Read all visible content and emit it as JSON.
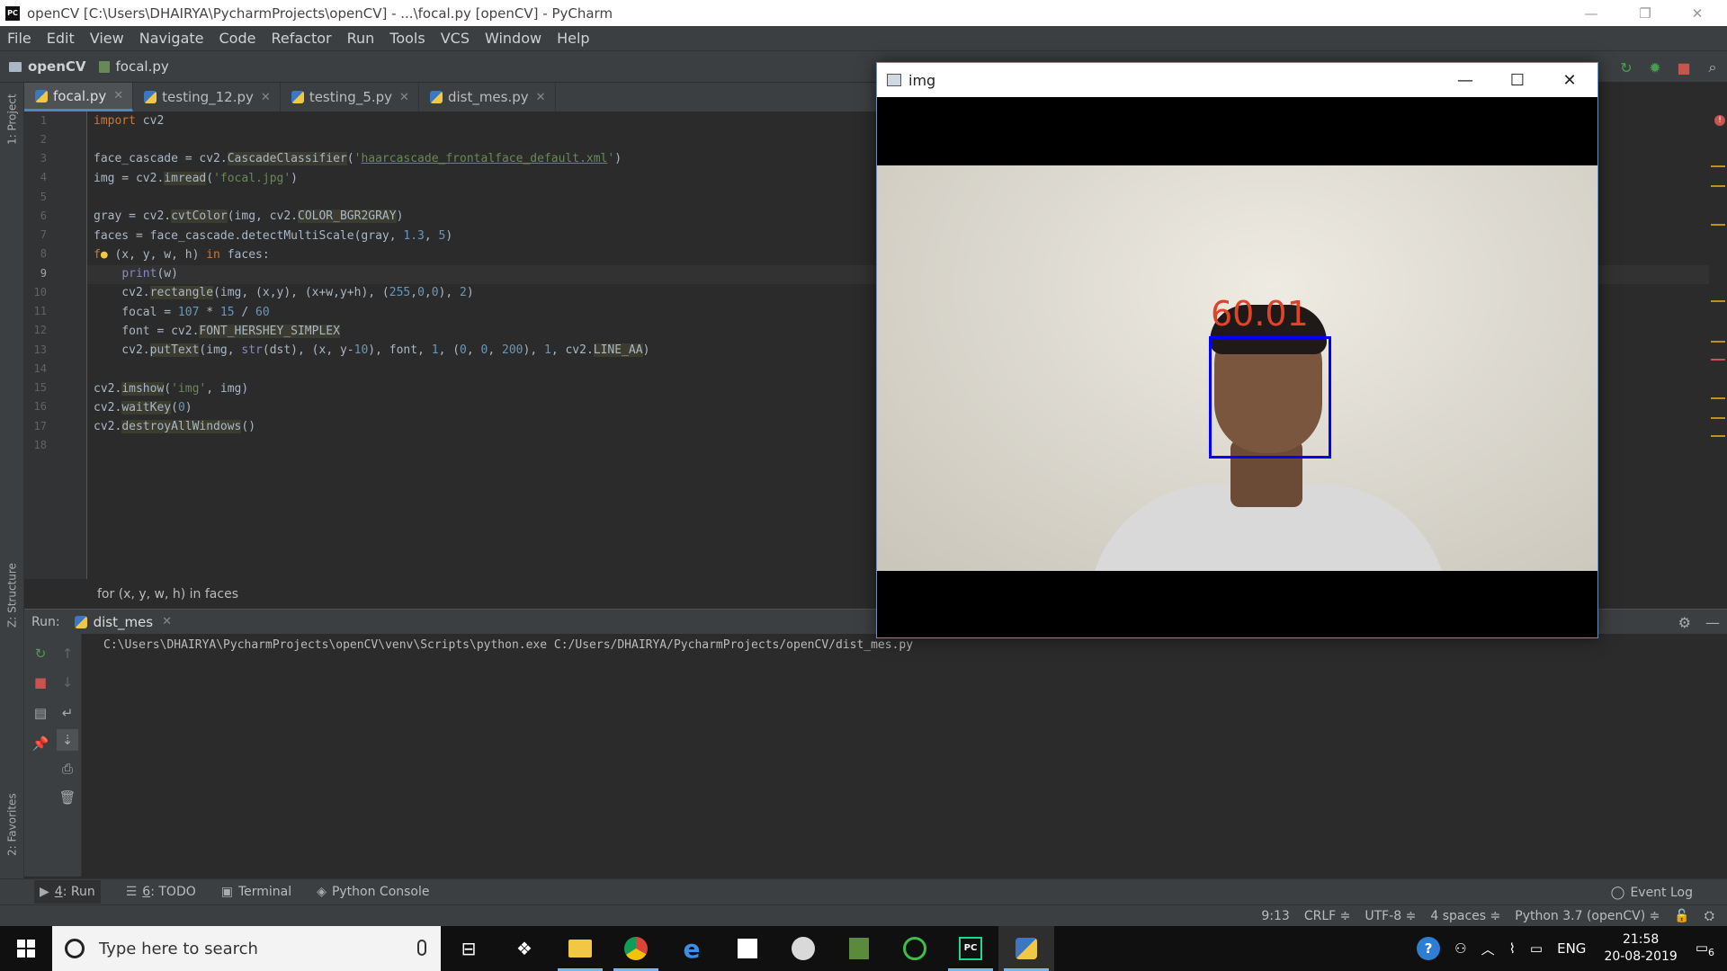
{
  "window": {
    "title": "openCV [C:\\Users\\DHAIRYA\\PycharmProjects\\openCV] - ...\\focal.py [openCV] - PyCharm",
    "logo": "PC"
  },
  "menu": [
    "File",
    "Edit",
    "View",
    "Navigate",
    "Code",
    "Refactor",
    "Run",
    "Tools",
    "VCS",
    "Window",
    "Help"
  ],
  "breadcrumb": {
    "project": "openCV",
    "file": "focal.py"
  },
  "side_tabs": {
    "project": "1: Project",
    "structure": "Z: Structure",
    "favorites": "2: Favorites"
  },
  "tabs": [
    {
      "label": "focal.py",
      "active": true
    },
    {
      "label": "testing_12.py",
      "active": false
    },
    {
      "label": "testing_5.py",
      "active": false
    },
    {
      "label": "dist_mes.py",
      "active": false
    }
  ],
  "code_lines": [
    "1",
    "2",
    "3",
    "4",
    "5",
    "6",
    "7",
    "8",
    "9",
    "10",
    "11",
    "12",
    "13",
    "14",
    "15",
    "16",
    "17",
    "18"
  ],
  "editor_breadcrumb": "for (x, y, w, h) in faces",
  "run": {
    "label": "Run:",
    "tab": "dist_mes",
    "output": "C:\\Users\\DHAIRYA\\PycharmProjects\\openCV\\venv\\Scripts\\python.exe C:/Users/DHAIRYA/PycharmProjects/openCV/dist_mes.py"
  },
  "bottom_tabs": {
    "run_num": "4",
    "run": ": Run",
    "todo_num": "6",
    "todo": ": TODO",
    "terminal": "Terminal",
    "console": "Python Console",
    "event_log": "Event Log"
  },
  "status": {
    "position": "9:13",
    "line_sep": "CRLF ≑",
    "encoding": "UTF-8 ≑",
    "indent": "4 spaces ≑",
    "interpreter": "Python 3.7 (openCV) ≑"
  },
  "cv_window": {
    "title": "img",
    "overlay_text": "60.01",
    "box_color": "#0000ff",
    "text_color": "#e0422a"
  },
  "taskbar": {
    "search_placeholder": "Type here to search",
    "lang": "ENG",
    "time": "21:58",
    "date": "20-08-2019",
    "notifications": "6"
  },
  "colors": {
    "accent": "#4a88c7",
    "keyword": "#cc7832",
    "string": "#6a8759",
    "number": "#6897bb"
  }
}
